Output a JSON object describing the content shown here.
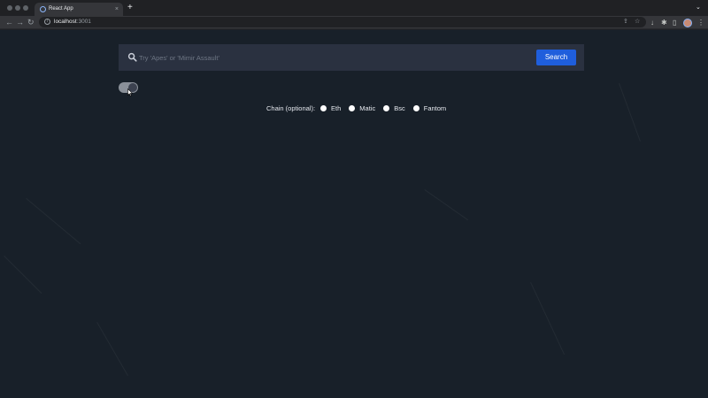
{
  "browser": {
    "tab_title": "React App",
    "tab_close": "×",
    "new_tab": "+",
    "tab_menu": "⌄",
    "url_host": "localhost",
    "url_port": ":3001",
    "icons": [
      "back-icon",
      "forward-icon",
      "reload-icon",
      "info-icon",
      "share-icon",
      "bookmark-star-icon",
      "download-icon",
      "extensions-icon",
      "sidebar-icon",
      "avatar",
      "menu-icon"
    ]
  },
  "search": {
    "placeholder": "Try 'Apes' or 'Mimir Assault'",
    "button_label": "Search",
    "value": ""
  },
  "toggle": {
    "on": true
  },
  "chain_filter": {
    "label": "Chain (optional):",
    "options": [
      {
        "label": "Eth"
      },
      {
        "label": "Matic"
      },
      {
        "label": "Bsc"
      },
      {
        "label": "Fantom"
      }
    ]
  },
  "colors": {
    "page_background": "#182029",
    "search_panel": "#2a3140",
    "search_button": "#1f5edc",
    "toggle_track": "#8a9099"
  }
}
